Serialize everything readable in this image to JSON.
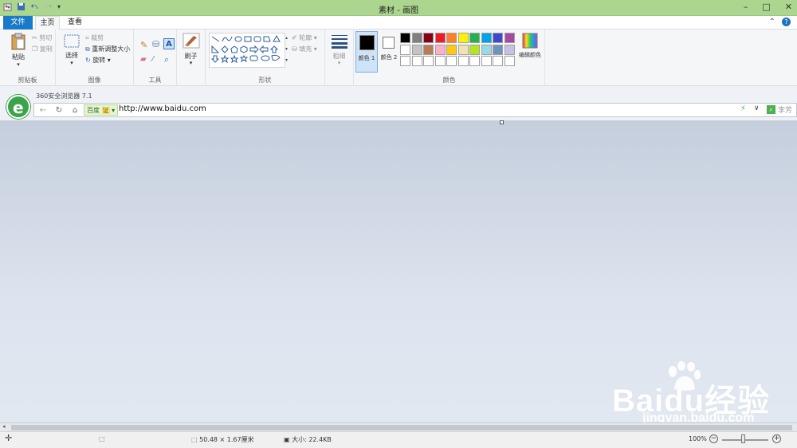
{
  "window": {
    "title": "素材 - 画图",
    "minimize": "–",
    "maximize": "□",
    "close": "✕"
  },
  "tabs": {
    "file": "文件",
    "home": "主页",
    "view": "查看"
  },
  "ribbon": {
    "clipboard": {
      "paste": "粘贴",
      "cut": "剪切",
      "copy": "复制",
      "label": "剪贴板"
    },
    "image": {
      "select": "选择",
      "crop": "裁剪",
      "resize": "重新调整大小",
      "rotate": "旋转",
      "label": "图像"
    },
    "tools": {
      "label": "工具",
      "text": "A"
    },
    "brushes": {
      "label": "刷子"
    },
    "shapes": {
      "outline": "轮廓",
      "fill": "填充",
      "label": "形状"
    },
    "size": {
      "label": "粗细"
    },
    "colors": {
      "color1": "颜色 1",
      "color2": "颜色 2",
      "edit": "编辑颜色",
      "label": "颜色",
      "palette_row1": [
        "#000000",
        "#7f7f7f",
        "#880015",
        "#ed1c24",
        "#ff7f27",
        "#fff200",
        "#22b14c",
        "#00a2e8",
        "#3f48cc",
        "#a349a4"
      ],
      "palette_row2": [
        "#ffffff",
        "#c3c3c3",
        "#b97a57",
        "#ffaec9",
        "#ffc90e",
        "#efe4b0",
        "#b5e61d",
        "#99d9ea",
        "#7092be",
        "#c8bfe7"
      ],
      "palette_row3": [
        "#ffffff",
        "#ffffff",
        "#ffffff",
        "#ffffff",
        "#ffffff",
        "#ffffff",
        "#ffffff",
        "#ffffff",
        "#ffffff",
        "#ffffff"
      ]
    }
  },
  "browser": {
    "title": "360安全浏览器 7.1",
    "engine": "百度",
    "engine_badge": "证",
    "url": "http://www.baidu.com",
    "search_hint": "李芳"
  },
  "status": {
    "dimensions": "50.48 × 1.67厘米",
    "size": "大小: 22.4KB",
    "zoom": "100%"
  },
  "watermark": {
    "main": "Baidu经验",
    "sub": "jingyan.baidu.com"
  }
}
